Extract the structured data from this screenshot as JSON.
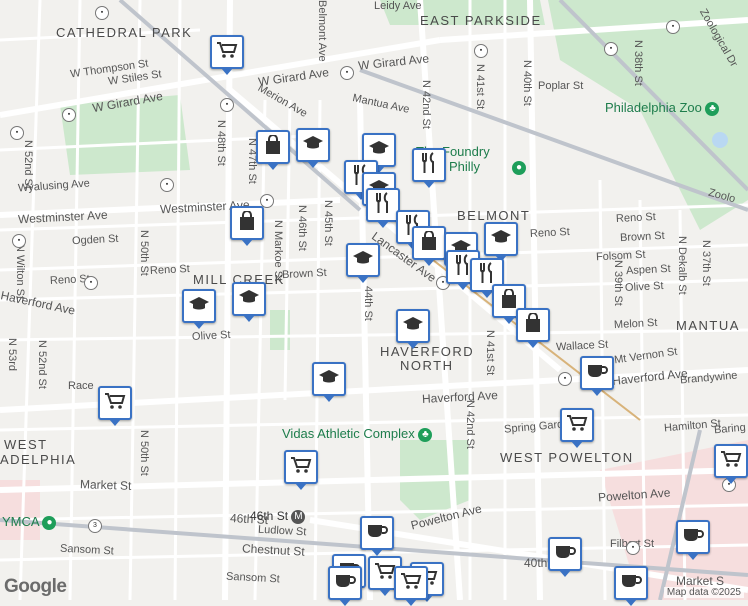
{
  "areas": [
    {
      "text": "EAST PARKSIDE",
      "name": "area-east-parkside"
    },
    {
      "text": "CATHEDRAL PARK",
      "name": "area-cathedral-park"
    },
    {
      "text": "BELMONT",
      "name": "area-belmont"
    },
    {
      "text": "MILL CREEK",
      "name": "area-mill-creek"
    },
    {
      "text": "HAVERFORD",
      "name": "area-haverford"
    },
    {
      "text": "NORTH",
      "name": "area-north"
    },
    {
      "text": "MANTUA",
      "name": "area-mantua"
    },
    {
      "text": "WEST POWELTON",
      "name": "area-west-powelton"
    },
    {
      "text": "WEST",
      "name": "area-west"
    },
    {
      "text": "ADELPHIA",
      "name": "area-adelphia"
    }
  ],
  "roads": {
    "w_thompson": "W Thompson St",
    "w_stiles": "W Stiles St",
    "w_girard_1": "W Girard Ave",
    "w_girard_2": "W Girard Ave",
    "w_girard_3": "W Girard Ave",
    "poplar": "Poplar St",
    "mantua": "Mantua Ave",
    "merion": "Merion Ave",
    "wyalusing": "Wyalusing Ave",
    "westminster_1": "Westminster Ave",
    "westminster_2": "Westminster Ave",
    "ogden": "Ogden St",
    "reno_1": "Reno St",
    "reno_2": "Reno St",
    "reno_3": "Reno St",
    "brown_1": "Brown St",
    "brown_2": "Brown St",
    "folsom": "Folsom St",
    "aspen": "Aspen St",
    "olive_1": "Olive St",
    "olive_2": "Olive St",
    "melon": "Melon St",
    "mt_vernon": "Mt Vernon St",
    "wallace": "Wallace St",
    "haverford_1": "Haverford Ave",
    "haverford_2": "Haverford Ave",
    "haverford_3": "Haverford Ave",
    "brandywine": "Brandywine",
    "race": "Race",
    "spring_garden": "Spring Garden St",
    "hamilton": "Hamilton St",
    "baring": "Baring",
    "market_1": "Market St",
    "market_2": "Market St",
    "powelton_1": "Powelton Ave",
    "powelton_2": "Powelton Ave",
    "ludlow": "Ludlow St",
    "sansom_1": "Sansom St",
    "sansom_2": "Sansom St",
    "chestnut": "Chestnut St",
    "filbert": "Filbert St",
    "st_46th": "46th St",
    "st_40th": "40th",
    "zooligical": "Zoological Dr",
    "zoolo": "Zoolo",
    "lancaster": "Lancaster Ave",
    "n_52nd": "N 52nd St",
    "n_50th": "N 50th St",
    "n_48th": "N 48th St",
    "n_47th": "N 47th St",
    "n_46th": "N 46th St",
    "n_45th": "N 45th St",
    "n_markoe": "N Markoe St",
    "n_44th": "44th St",
    "n_43rd": "N 43rd St",
    "n_42nd_1": "N 42nd St",
    "n_42nd_2": "N 42nd St",
    "n_41st_1": "N 41st St",
    "n_41st_2": "N 41st St",
    "n_40th": "N 40th St",
    "n_39th": "N 39th St",
    "n_38th": "N 38th St",
    "n_37th": "N 37th St",
    "n_dekalb": "N Dekalb St",
    "n_wilton": "N Wilton St",
    "n_53rd": "N 53rd",
    "n_50th_b": "N 50th St",
    "belmont_ave": "Belmont Ave",
    "leidy": "Leidy Ave",
    "aspen_w": "Aspen St",
    "olive_w": "Olive St",
    "haverford_w": "Haverford Ave",
    "market_mk": "Market S",
    "st_n_46": "N 46th St",
    "st_48th": "48th St"
  },
  "pois": {
    "foundry": "The Foundry West Philly",
    "zoo": "Philadelphia Zoo",
    "vidas": "Vidas Athletic Complex",
    "ymca": "YMCA",
    "station": "46th St"
  },
  "marker_types": [
    "grocery-icon",
    "shopping-bag-icon",
    "school-icon",
    "restaurant-icon",
    "coffee-icon"
  ],
  "attribution": {
    "logo": "Google",
    "data": "Map data ©2025"
  },
  "colors": {
    "land": "#f2f1ee",
    "park": "#c8e6c9",
    "road": "#ffffff",
    "highway": "#b7bcc7",
    "marker_border": "#3a72c4",
    "poi_green": "#1e9e5a"
  }
}
